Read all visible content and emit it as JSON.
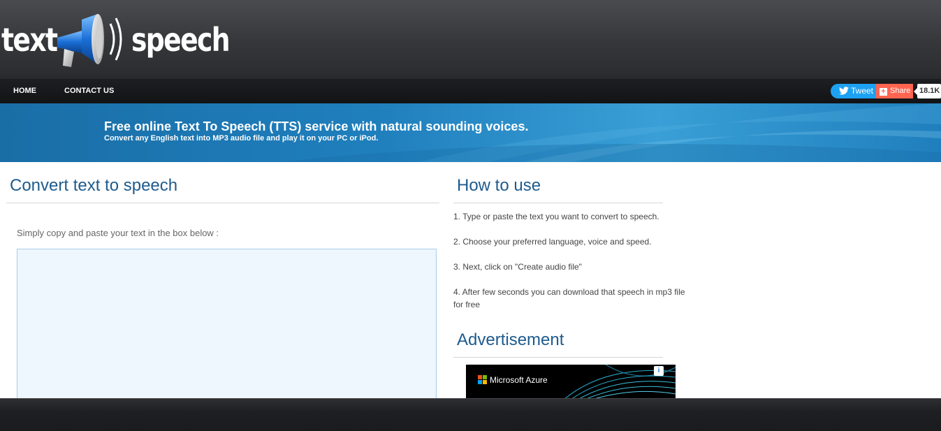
{
  "logo": {
    "left_word": "text",
    "right_word": "speech",
    "icon": "megaphone-icon"
  },
  "nav": {
    "home": "HOME",
    "contact": "CONTACT US",
    "tweet_label": "Tweet",
    "share_label": "Share",
    "share_count": "18.1K"
  },
  "banner": {
    "title": "Free online Text To Speech (TTS) service with natural sounding voices.",
    "subtitle": "Convert any English text into MP3 audio file and play it on your PC or iPod."
  },
  "main": {
    "heading": "Convert text to speech",
    "instruction": "Simply copy and paste your text in the box below :",
    "text_value": ""
  },
  "how_to_use": {
    "heading": "How to use",
    "steps": [
      "1. Type or paste the text you want to convert to speech.",
      "2. Choose your preferred language, voice and speed.",
      "3. Next, click on \"Create audio file\"",
      "4. After few seconds you can download that speech in mp3 file for free"
    ]
  },
  "advertisement": {
    "heading": "Advertisement",
    "ad_text": "Microsoft Azure",
    "info_icon": "info-icon"
  },
  "colors": {
    "heading_blue": "#1e5b8e",
    "banner_blue": "#1f7fbd",
    "tweet_blue": "#1da1f2",
    "share_orange": "#ff6550"
  }
}
